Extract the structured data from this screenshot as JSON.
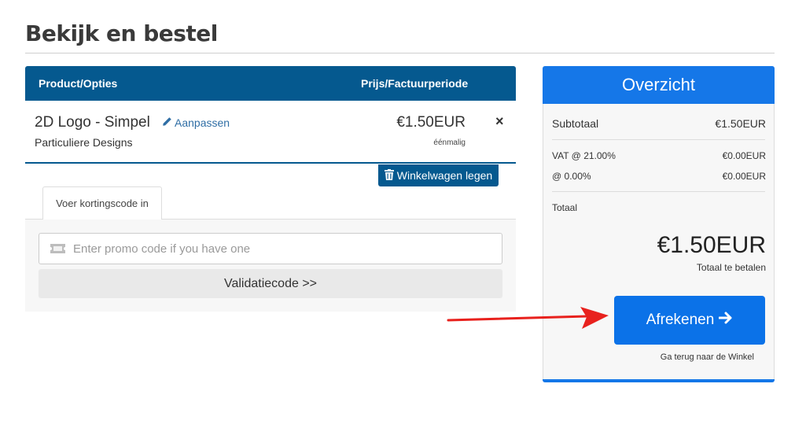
{
  "page": {
    "title": "Bekijk en bestel"
  },
  "cart": {
    "header": {
      "product_col": "Product/Opties",
      "price_col": "Prijs/Factuurperiode"
    },
    "item": {
      "name": "2D Logo - Simpel",
      "edit_label": "Aanpassen",
      "group": "Particuliere Designs",
      "price": "€1.50EUR",
      "period": "éénmalig",
      "remove_symbol": "×"
    },
    "empty_cart_label": "Winkelwagen legen"
  },
  "promo": {
    "tab_label": "Voer kortingscode in",
    "input_placeholder": "Enter promo code if you have one",
    "input_value": "",
    "validate_label": "Validatiecode >>"
  },
  "summary": {
    "title": "Overzicht",
    "subtotal_label": "Subtotaal",
    "subtotal_value": "€1.50EUR",
    "vat1_label": "VAT @ 21.00%",
    "vat1_value": "€0.00EUR",
    "vat2_label": "@ 0.00%",
    "vat2_value": "€0.00EUR",
    "total_label": "Totaal",
    "total_amount": "€1.50EUR",
    "total_amount_label": "Totaal te betalen",
    "checkout_label": "Afrekenen",
    "back_link": "Ga terug naar de Winkel"
  },
  "icons": {
    "edit": "pencil-icon",
    "remove": "close-icon",
    "empty_cart": "trash-icon",
    "promo": "ticket-icon",
    "checkout": "arrow-right-icon"
  },
  "colors": {
    "header_blue": "#05598f",
    "summary_blue": "#1577e8",
    "checkout_blue": "#0b72e8",
    "link_blue": "#2f6ea5",
    "annotation_red": "#e8211d"
  }
}
